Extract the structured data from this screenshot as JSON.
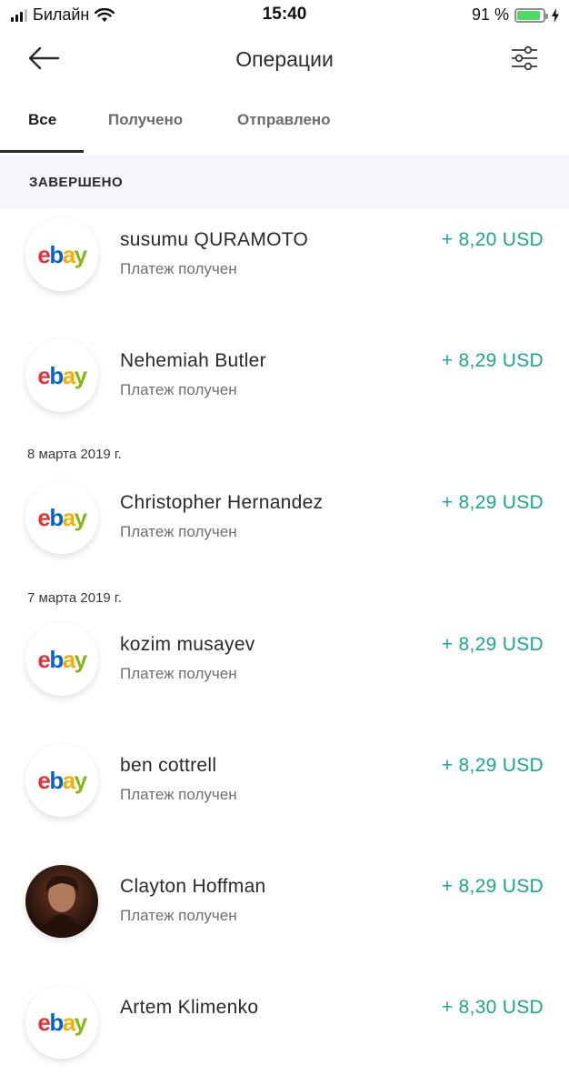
{
  "status_bar": {
    "carrier": "Билайн",
    "time": "15:40",
    "battery": "91 %",
    "battery_level": 0.91
  },
  "header": {
    "title": "Операции",
    "back_icon": "arrow-left-icon",
    "filter_icon": "sliders-icon"
  },
  "tabs": [
    {
      "label": "Все",
      "active": true
    },
    {
      "label": "Получено",
      "active": false
    },
    {
      "label": "Отправлено",
      "active": false
    }
  ],
  "section": {
    "title": "ЗАВЕРШЕНО"
  },
  "dates": [
    "8 марта 2019 г.",
    "7 марта 2019 г."
  ],
  "transactions": [
    {
      "name": "susumu QURAMOTO",
      "status": "Платеж получен",
      "amount": "+ 8,20 USD",
      "avatar": "ebay"
    },
    {
      "name": "Nehemiah Butler",
      "status": "Платеж получен",
      "amount": "+ 8,29 USD",
      "avatar": "ebay"
    },
    {
      "name": "Christopher Hernandez",
      "status": "Платеж получен",
      "amount": "+ 8,29 USD",
      "avatar": "ebay"
    },
    {
      "name": "kozim musayev",
      "status": "Платеж получен",
      "amount": "+ 8,29 USD",
      "avatar": "ebay"
    },
    {
      "name": "ben cottrell",
      "status": "Платеж получен",
      "amount": "+ 8,29 USD",
      "avatar": "ebay"
    },
    {
      "name": "Clayton Hoffman",
      "status": "Платеж получен",
      "amount": "+ 8,29 USD",
      "avatar": "photo"
    },
    {
      "name": "Artem Klimenko",
      "status": "",
      "amount": "+ 8,30 USD",
      "avatar": "ebay"
    }
  ],
  "colors": {
    "amount_green": "#1aa88a",
    "section_bg": "#f5f6fa",
    "ebay_e": "#e53238",
    "ebay_b": "#0064d2",
    "ebay_a": "#f5af02",
    "ebay_y": "#86b817"
  }
}
